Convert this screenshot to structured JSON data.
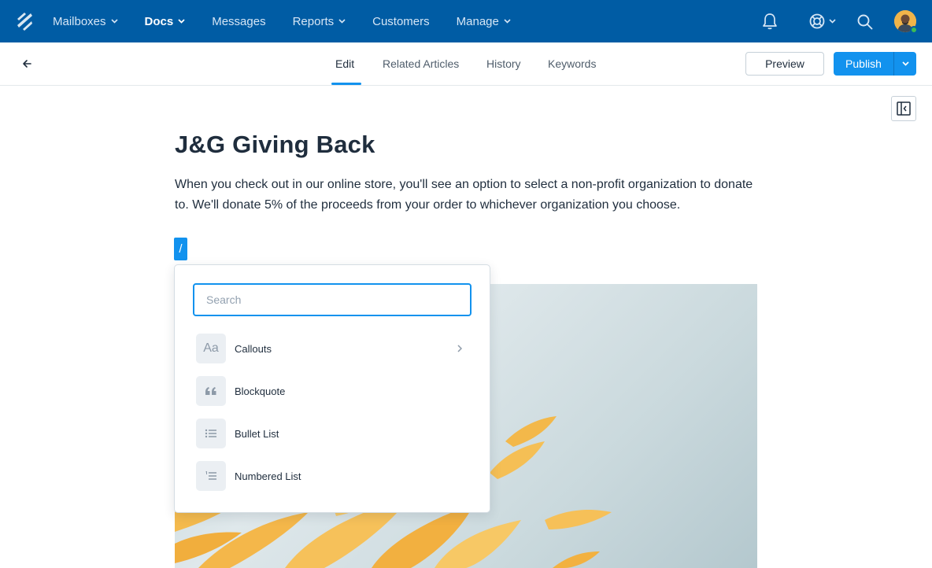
{
  "nav": {
    "items": [
      {
        "label": "Mailboxes",
        "dropdown": true,
        "active": false
      },
      {
        "label": "Docs",
        "dropdown": true,
        "active": true
      },
      {
        "label": "Messages",
        "dropdown": false,
        "active": false
      },
      {
        "label": "Reports",
        "dropdown": true,
        "active": false
      },
      {
        "label": "Customers",
        "dropdown": false,
        "active": false
      },
      {
        "label": "Manage",
        "dropdown": true,
        "active": false
      }
    ],
    "icons": [
      "logo-icon",
      "bell-icon",
      "help-icon",
      "search-icon",
      "avatar"
    ]
  },
  "toolbar": {
    "tabs": [
      "Edit",
      "Related Articles",
      "History",
      "Keywords"
    ],
    "active_tab": "Edit",
    "preview_label": "Preview",
    "publish_label": "Publish"
  },
  "article": {
    "title": "J&G Giving Back",
    "body": "When you check out in our online store, you'll see an option to select a non-profit organization to donate to. We'll donate 5% of the proceeds from your order to whichever organization you choose.",
    "slash_command": "/"
  },
  "menu": {
    "search_placeholder": "Search",
    "items": [
      {
        "label": "Callouts",
        "icon": "Aa",
        "submenu": true
      },
      {
        "label": "Blockquote",
        "icon": "quote-icon",
        "submenu": false
      },
      {
        "label": "Bullet List",
        "icon": "bullet-list-icon",
        "submenu": false
      },
      {
        "label": "Numbered List",
        "icon": "numbered-list-icon",
        "submenu": false
      }
    ]
  },
  "colors": {
    "nav_bg": "#005ca4",
    "accent": "#1292ee",
    "text": "#1f2d3d"
  }
}
